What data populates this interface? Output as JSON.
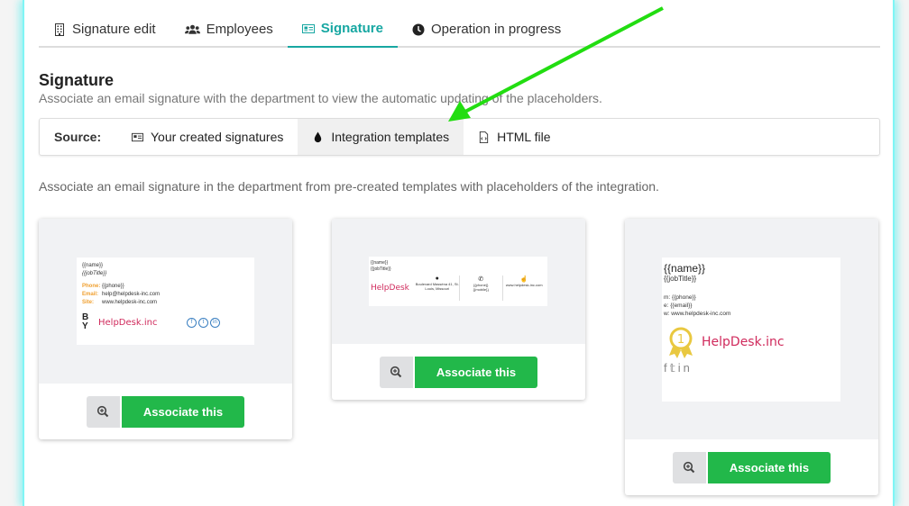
{
  "tabs": [
    {
      "label": "Signature edit",
      "icon": "building-icon",
      "active": false
    },
    {
      "label": "Employees",
      "icon": "users-icon",
      "active": false
    },
    {
      "label": "Signature",
      "icon": "id-card-icon",
      "active": true
    },
    {
      "label": "Operation in progress",
      "icon": "clock-icon",
      "active": false
    }
  ],
  "section": {
    "title": "Signature",
    "subtitle": "Associate an email signature with the department to view the automatic updating of the placeholders."
  },
  "source": {
    "label": "Source:",
    "options": [
      {
        "label": "Your created signatures",
        "icon": "id-card-icon",
        "active": false
      },
      {
        "label": "Integration templates",
        "icon": "drop-icon",
        "active": true
      },
      {
        "label": "HTML file",
        "icon": "file-code-icon",
        "active": false
      }
    ]
  },
  "intro": "Associate an email signature in the department from pre-created templates with placeholders of the integration.",
  "templates": [
    {
      "name": "{{name}}",
      "job": "{{jobTitle}}",
      "phone_label": "Phone:",
      "phone": "{{phone}}",
      "email_label": "Email:",
      "email": "help@helpdesk-inc.com",
      "site_label": "Site:",
      "site": "www.helpdesk-inc.com",
      "logo_letters": "B\nY",
      "brand": "HelpDesk.inc",
      "button": "Associate this"
    },
    {
      "name": "{{name}}",
      "job": "{{jobTitle}}",
      "brand": "HelpDesk",
      "address": "Boulevard Masséna 41, St. Louis, Missouri",
      "phone": "{{phone}}",
      "mobile": "{{mobile}}",
      "site": "www.helpdesk-inc.com",
      "button": "Associate this"
    },
    {
      "name": "{{name}}",
      "job": "{{jobTitle}}",
      "m": "m: {{phone}}",
      "e": "e: {{email}}",
      "w": "w: www.helpdesk-inc.com",
      "brand": "HelpDesk.inc",
      "badge": "1",
      "button": "Associate this"
    }
  ],
  "colors": {
    "accent": "#17a7a2",
    "button": "#22b84a",
    "annotation_arrow": "#22dd11"
  }
}
